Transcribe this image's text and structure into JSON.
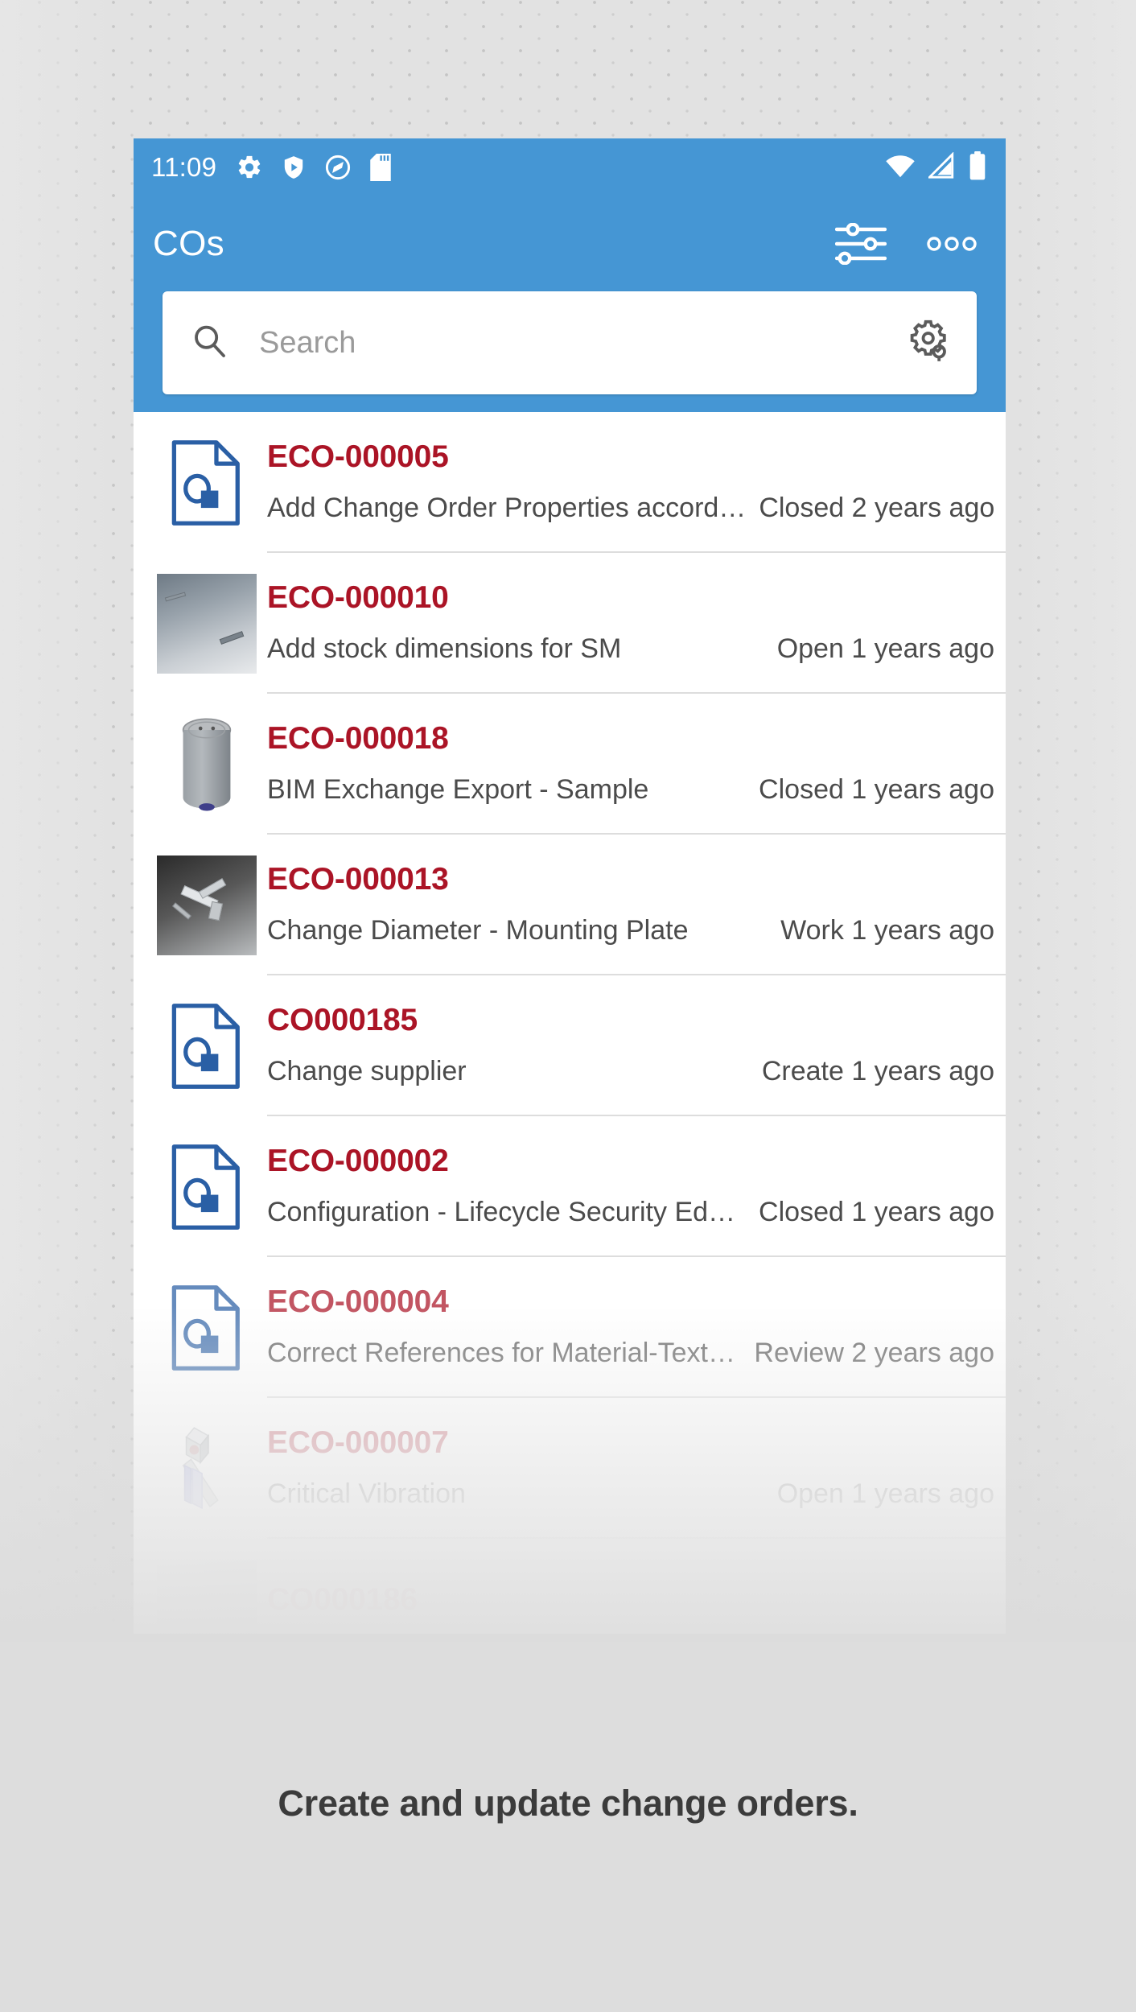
{
  "statusbar": {
    "time": "11:09",
    "left_icons": [
      "gear-icon",
      "shield-play-icon",
      "circle-slash-icon",
      "sd-card-icon"
    ],
    "right_icons": [
      "wifi-icon",
      "signal-icon",
      "battery-icon"
    ]
  },
  "appbar": {
    "title": "COs",
    "filter_icon": "sliders-icon",
    "overflow_icon": "overflow-menu-icon"
  },
  "search": {
    "placeholder": "Search",
    "value": "",
    "search_icon": "search-icon",
    "settings_icon": "gear-settings-icon"
  },
  "colors": {
    "accent_blue": "#4596d4",
    "id_red": "#ab1426",
    "doc_icon_blue": "#2a5fa5",
    "text_grey": "#4b4b4b"
  },
  "list": {
    "rows": [
      {
        "id": "ECO-000005",
        "description": "Add Change Order Properties accord…",
        "status": "Closed 2 years ago",
        "thumb": "document-icon"
      },
      {
        "id": "ECO-000010",
        "description": "Add stock dimensions for SM",
        "status": "Open 1 years ago",
        "thumb": "cad-preview-sheetmetal"
      },
      {
        "id": "ECO-000018",
        "description": "BIM Exchange Export - Sample",
        "status": "Closed 1 years ago",
        "thumb": "cad-preview-cylinder"
      },
      {
        "id": "ECO-000013",
        "description": "Change Diameter - Mounting Plate",
        "status": "Work 1 years ago",
        "thumb": "cad-preview-mounting-plate"
      },
      {
        "id": "CO000185",
        "description": "Change supplier",
        "status": "Create 1 years ago",
        "thumb": "document-icon"
      },
      {
        "id": "ECO-000002",
        "description": "Configuration - Lifecycle Security Ed…",
        "status": "Closed 1 years ago",
        "thumb": "document-icon"
      },
      {
        "id": "ECO-000004",
        "description": "Correct References for Material-Text…",
        "status": "Review 2 years ago",
        "thumb": "document-icon"
      },
      {
        "id": "ECO-000007",
        "description": "Critical Vibration",
        "status": "Open 1 years ago",
        "thumb": "cad-preview-bracket"
      },
      {
        "id": "CO000186",
        "description": "",
        "status": "",
        "thumb": "cad-preview-partial"
      }
    ]
  },
  "caption": {
    "text": "Create and update change orders."
  }
}
